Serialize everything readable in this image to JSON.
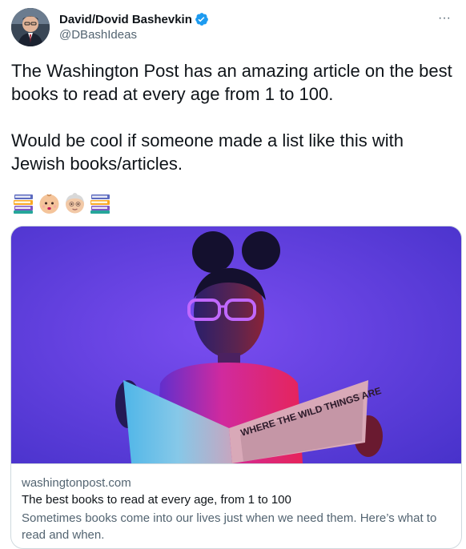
{
  "author": {
    "display_name": "David/Dovid Bashevkin",
    "handle": "@DBashIdeas",
    "verified": true
  },
  "tweet": {
    "text": "The Washington Post has an amazing article on the best books to read at every age from 1 to 100.\n\nWould be cool if someone made a list like this with Jewish books/articles.",
    "emojis": [
      "books-icon",
      "baby-icon",
      "older-person-icon",
      "books-icon"
    ]
  },
  "card": {
    "domain": "washingtonpost.com",
    "title": "The best books to read at every age, from 1 to 100",
    "description": "Sometimes books come into our lives just when we need them. Here’s what to read and when.",
    "book_cover_text": "WHERE THE WILD THINGS ARE"
  },
  "menu": {
    "more_label": "···"
  },
  "colors": {
    "text": "#0f1419",
    "secondary": "#536471",
    "verified": "#1d9bf0",
    "border": "#cfd9de",
    "image_background": "#5b3fd6"
  }
}
